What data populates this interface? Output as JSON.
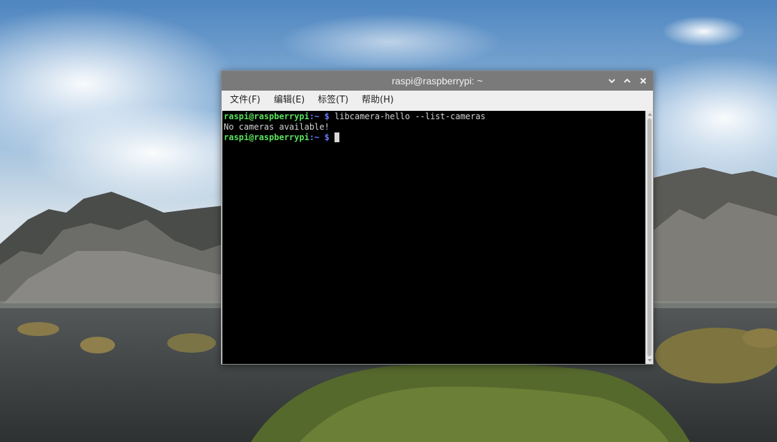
{
  "window": {
    "title": "raspi@raspberrypi: ~"
  },
  "menu": {
    "file": "文件(F)",
    "edit": "编辑(E)",
    "tabs": "标签(T)",
    "help": "帮助(H)"
  },
  "terminal": {
    "line1": {
      "user": "raspi@raspberrypi",
      "path": ":~ $",
      "command": " libcamera-hello --list-cameras"
    },
    "line2": "No cameras available!",
    "line3": {
      "user": "raspi@raspberrypi",
      "path": ":~ $",
      "command": " "
    }
  },
  "colors": {
    "prompt_user": "#59e25d",
    "prompt_path": "#6c7cff",
    "terminal_bg": "#000000",
    "terminal_fg": "#d3d3d3",
    "titlebar_bg": "#7a7a7a"
  },
  "icons": {
    "minimize": "chevron-down-icon",
    "maximize": "chevron-up-icon",
    "close": "close-icon"
  }
}
